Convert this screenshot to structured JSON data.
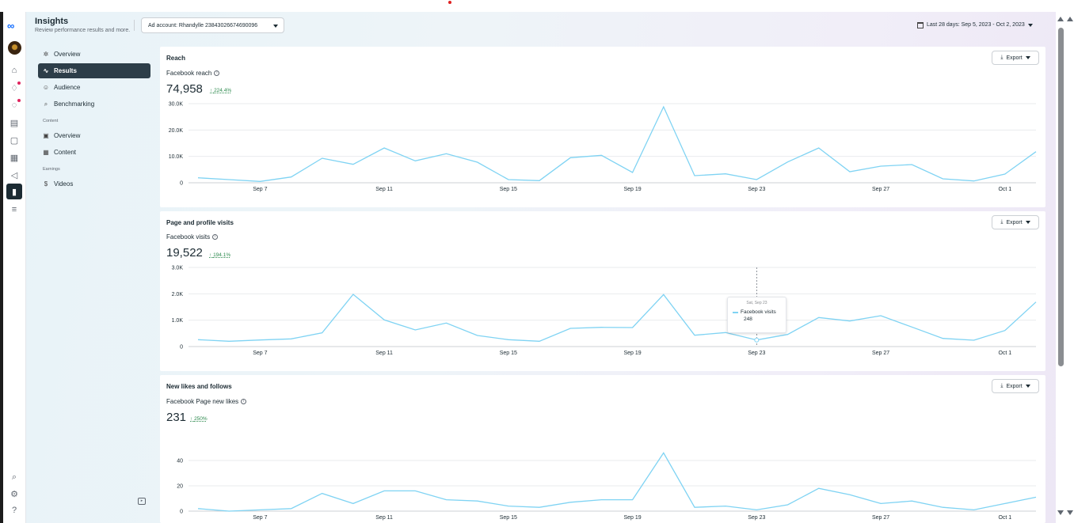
{
  "header": {
    "title": "Insights",
    "subtitle": "Review performance results and more.",
    "ad_account": "Ad account: Rhandylle 23843026674690096",
    "date_range": "Last 28 days: Sep 5, 2023 - Oct 2, 2023"
  },
  "rail_icons": [
    "meta-logo",
    "avatar",
    "home-icon",
    "notifications-icon",
    "activity-icon",
    "contact-card-icon",
    "pages-icon",
    "grid-icon",
    "ads-megaphone-icon",
    "insights-icon",
    "menu-icon",
    "search-icon",
    "settings-icon",
    "help-icon"
  ],
  "nav": {
    "items": [
      {
        "label": "Overview",
        "icon": "overview-icon",
        "active": false
      },
      {
        "label": "Results",
        "icon": "results-icon",
        "active": true
      },
      {
        "label": "Audience",
        "icon": "audience-icon",
        "active": false
      },
      {
        "label": "Benchmarking",
        "icon": "benchmarking-icon",
        "active": false
      }
    ],
    "content_section": "Content",
    "content_items": [
      {
        "label": "Overview",
        "icon": "content-overview-icon"
      },
      {
        "label": "Content",
        "icon": "content-table-icon"
      }
    ],
    "earnings_section": "Earnings",
    "earnings_items": [
      {
        "label": "Videos",
        "icon": "dollar-icon"
      }
    ]
  },
  "export_label": "Export",
  "x_ticks": [
    "Sep 7",
    "Sep 11",
    "Sep 15",
    "Sep 19",
    "Sep 23",
    "Sep 27",
    "Oct 1"
  ],
  "cards": [
    {
      "title": "Reach",
      "metric_label": "Facebook reach",
      "metric_value": "74,958",
      "metric_change": "224.4%"
    },
    {
      "title": "Page and profile visits",
      "metric_label": "Facebook visits",
      "metric_value": "19,522",
      "metric_change": "194.1%",
      "tooltip": {
        "date": "Sat, Sep 23",
        "series": "Facebook visits",
        "value": "248"
      }
    },
    {
      "title": "New likes and follows",
      "metric_label": "Facebook Page new likes",
      "metric_value": "231",
      "metric_change": "250%"
    }
  ],
  "chart_data": [
    {
      "type": "line",
      "x": [
        "Sep 5",
        "Sep 6",
        "Sep 7",
        "Sep 8",
        "Sep 9",
        "Sep 10",
        "Sep 11",
        "Sep 12",
        "Sep 13",
        "Sep 14",
        "Sep 15",
        "Sep 16",
        "Sep 17",
        "Sep 18",
        "Sep 19",
        "Sep 20",
        "Sep 21",
        "Sep 22",
        "Sep 23",
        "Sep 24",
        "Sep 25",
        "Sep 26",
        "Sep 27",
        "Sep 28",
        "Sep 29",
        "Sep 30",
        "Oct 1",
        "Oct 2"
      ],
      "series": [
        {
          "name": "Facebook reach",
          "values": [
            1900,
            1200,
            500,
            2200,
            9300,
            7000,
            13200,
            8300,
            11000,
            7800,
            1200,
            800,
            9500,
            10400,
            3900,
            28800,
            2700,
            3400,
            1200,
            7900,
            13200,
            4200,
            6300,
            6900,
            1500,
            700,
            3300,
            11800
          ]
        }
      ],
      "yticks": [
        "0",
        "10.0K",
        "20.0K",
        "30.0K"
      ],
      "ylim": [
        0,
        30000
      ],
      "color": "#7fd3f3"
    },
    {
      "type": "line",
      "x": [
        "Sep 5",
        "Sep 6",
        "Sep 7",
        "Sep 8",
        "Sep 9",
        "Sep 10",
        "Sep 11",
        "Sep 12",
        "Sep 13",
        "Sep 14",
        "Sep 15",
        "Sep 16",
        "Sep 17",
        "Sep 18",
        "Sep 19",
        "Sep 20",
        "Sep 21",
        "Sep 22",
        "Sep 23",
        "Sep 24",
        "Sep 25",
        "Sep 26",
        "Sep 27",
        "Sep 28",
        "Sep 29",
        "Sep 30",
        "Oct 1",
        "Oct 2"
      ],
      "series": [
        {
          "name": "Facebook visits",
          "values": [
            260,
            200,
            250,
            290,
            520,
            1980,
            1010,
            630,
            890,
            420,
            260,
            200,
            690,
            730,
            720,
            1970,
            430,
            530,
            248,
            460,
            1100,
            970,
            1170,
            740,
            310,
            240,
            610,
            1690
          ]
        }
      ],
      "yticks": [
        "0",
        "1.0K",
        "2.0K",
        "3.0K"
      ],
      "ylim": [
        0,
        3000
      ],
      "color": "#7fd3f3"
    },
    {
      "type": "line",
      "x": [
        "Sep 5",
        "Sep 6",
        "Sep 7",
        "Sep 8",
        "Sep 9",
        "Sep 10",
        "Sep 11",
        "Sep 12",
        "Sep 13",
        "Sep 14",
        "Sep 15",
        "Sep 16",
        "Sep 17",
        "Sep 18",
        "Sep 19",
        "Sep 20",
        "Sep 21",
        "Sep 22",
        "Sep 23",
        "Sep 24",
        "Sep 25",
        "Sep 26",
        "Sep 27",
        "Sep 28",
        "Sep 29",
        "Sep 30",
        "Oct 1",
        "Oct 2"
      ],
      "series": [
        {
          "name": "Facebook Page new likes",
          "values": [
            2,
            0,
            1,
            2,
            14,
            6,
            16,
            16,
            9,
            8,
            4,
            3,
            7,
            9,
            9,
            46,
            3,
            4,
            1,
            5,
            18,
            13,
            6,
            8,
            3,
            1,
            6,
            11
          ]
        }
      ],
      "yticks": [
        "0",
        "20",
        "40"
      ],
      "ylim": [
        0,
        50
      ],
      "color": "#7fd3f3"
    }
  ]
}
